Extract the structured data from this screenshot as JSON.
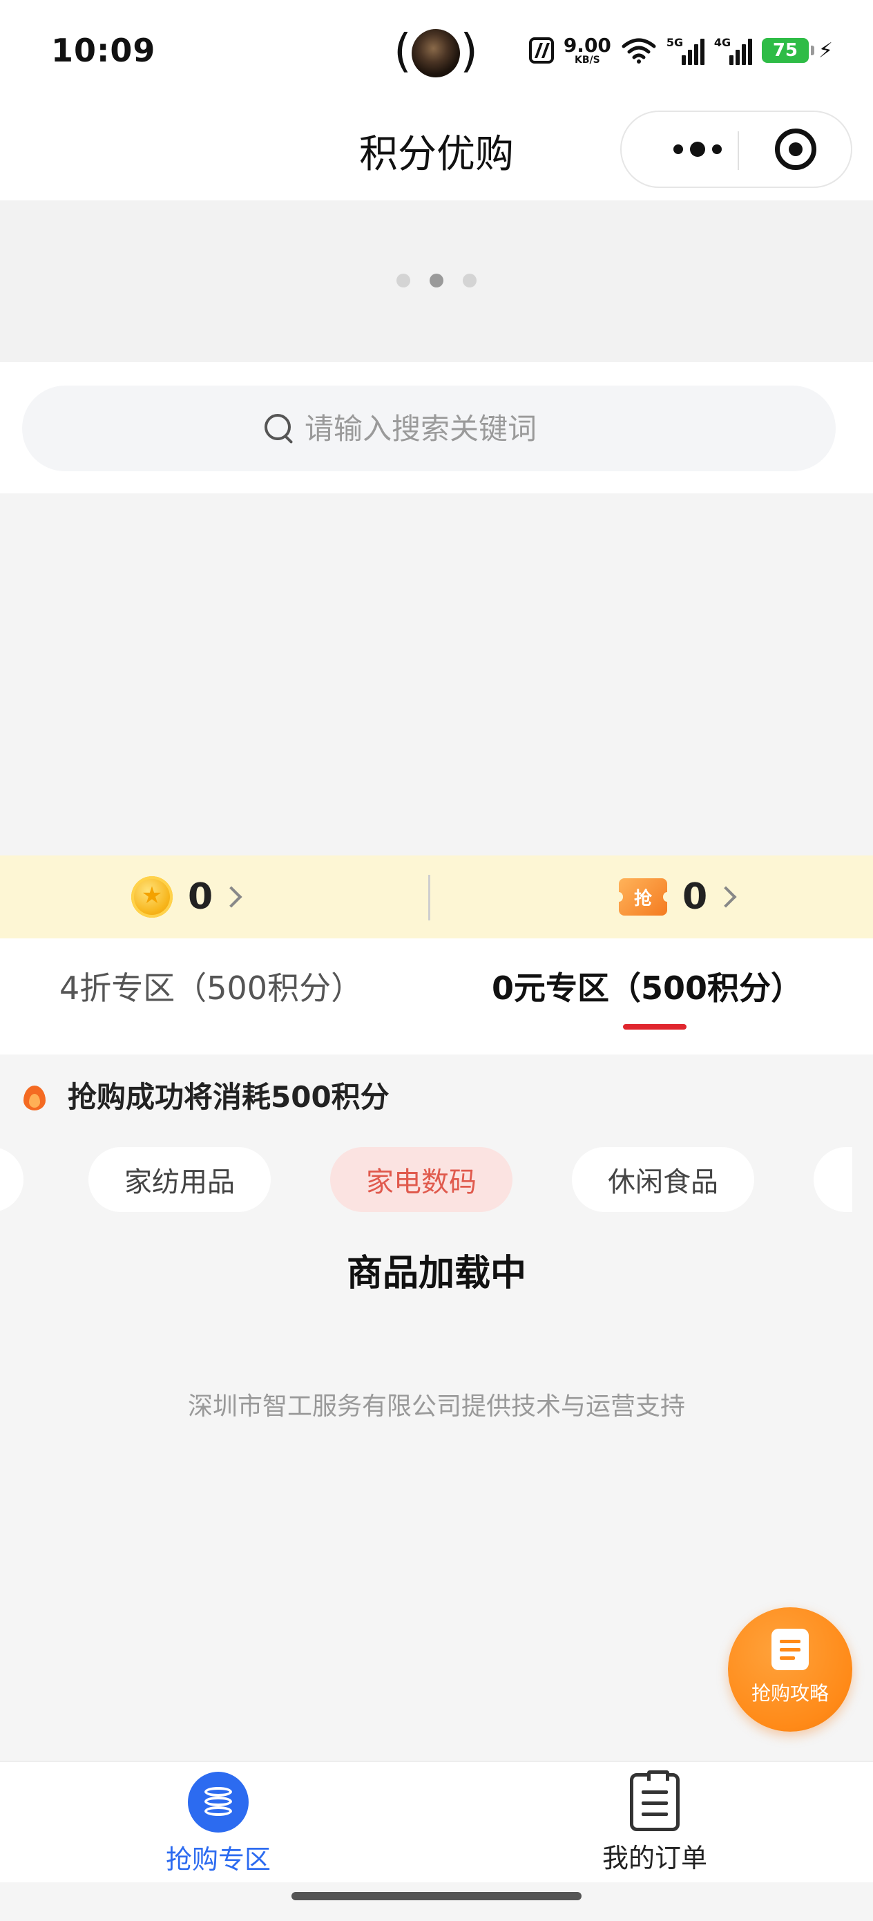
{
  "status_bar": {
    "time": "10:09",
    "net_speed_value": "9.00",
    "net_speed_unit": "KB/S",
    "wifi_tag": "6",
    "sim1_tag": "5G",
    "sim2_tag": "4G",
    "battery": "75",
    "battery_color": "#2ebc46"
  },
  "nav": {
    "title": "积分优购"
  },
  "banner": {
    "dot_count": 3,
    "active_dot": 1
  },
  "search": {
    "placeholder": "请输入搜索关键词",
    "value": ""
  },
  "points": {
    "coin_count": "0",
    "ticket_label": "抢",
    "ticket_count": "0"
  },
  "tabs": [
    {
      "label": "4折专区（500积分）",
      "active": false
    },
    {
      "label": "0元专区（500积分）",
      "active": true
    }
  ],
  "accent_color": "#e0262e",
  "notice": {
    "text": "抢购成功将消耗500积分"
  },
  "categories": [
    {
      "label": "家纺用品",
      "active": false
    },
    {
      "label": "家电数码",
      "active": true
    },
    {
      "label": "休闲食品",
      "active": false
    },
    {
      "label": "",
      "active": false
    }
  ],
  "loading_text": "商品加载中",
  "footer_note": "深圳市智工服务有限公司提供技术与运营支持",
  "float_button": {
    "label": "抢购攻略",
    "color": "#ff8a18"
  },
  "tab_bar": [
    {
      "label": "抢购专区",
      "icon": "database-icon",
      "active": true,
      "color": "#2c6bf0"
    },
    {
      "label": "我的订单",
      "icon": "order-list-icon",
      "active": false
    }
  ]
}
